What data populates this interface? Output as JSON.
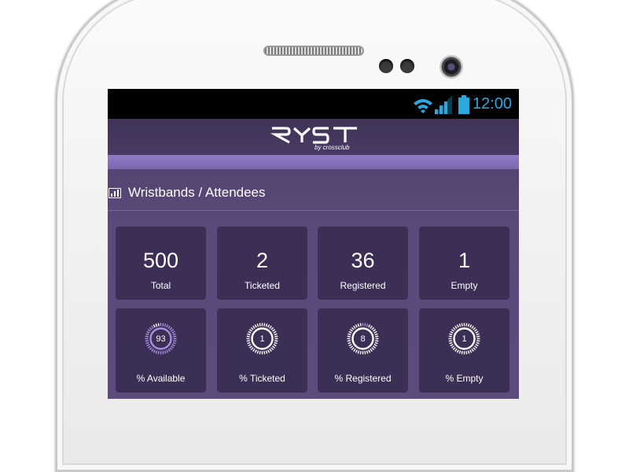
{
  "app": {
    "brand": "RYST",
    "brand_sub": "by crossclub"
  },
  "statusbar": {
    "time": "12:00"
  },
  "section": {
    "title": "Wristbands / Attendees"
  },
  "stats": [
    {
      "value": "500",
      "label": "Total"
    },
    {
      "value": "2",
      "label": "Ticketed"
    },
    {
      "value": "36",
      "label": "Registered"
    },
    {
      "value": "1",
      "label": "Empty"
    }
  ],
  "percentages": [
    {
      "value": "93",
      "label": "% Available",
      "fraction": 0.93
    },
    {
      "value": "1",
      "label": "% Ticketed",
      "fraction": 0.01
    },
    {
      "value": "8",
      "label": "% Registered",
      "fraction": 0.08
    },
    {
      "value": "1",
      "label": "% Empty",
      "fraction": 0.01
    }
  ],
  "colors": {
    "accent": "#8f7ac5",
    "status": "#2aa9dd",
    "gauge_fill": "#a98fe0"
  },
  "icons": {
    "wifi": "wifi-icon",
    "signal": "signal-icon",
    "battery": "battery-icon",
    "section": "bar-chart-icon"
  }
}
